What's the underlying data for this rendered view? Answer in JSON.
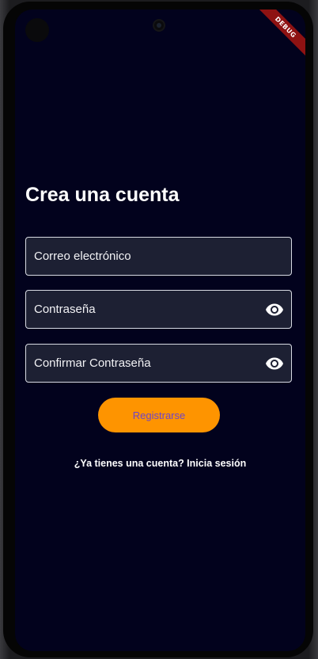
{
  "header": {
    "title": "Crea una cuenta",
    "debug_banner": "DEBUG"
  },
  "form": {
    "email": {
      "placeholder": "Correo electrónico",
      "value": ""
    },
    "password": {
      "placeholder": "Contraseña",
      "value": "",
      "toggle_icon": "eye-icon"
    },
    "confirm_password": {
      "placeholder": "Confirmar Contraseña",
      "value": "",
      "toggle_icon": "eye-icon"
    },
    "submit_label": "Registrarse"
  },
  "footer": {
    "login_prompt": "¿Ya tienes una cuenta? Inicia sesión"
  },
  "colors": {
    "background": "#02021d",
    "field_background": "#1d2033",
    "accent": "#fe9400",
    "button_text": "#6e44c9",
    "debug_ribbon": "#8e1212"
  }
}
